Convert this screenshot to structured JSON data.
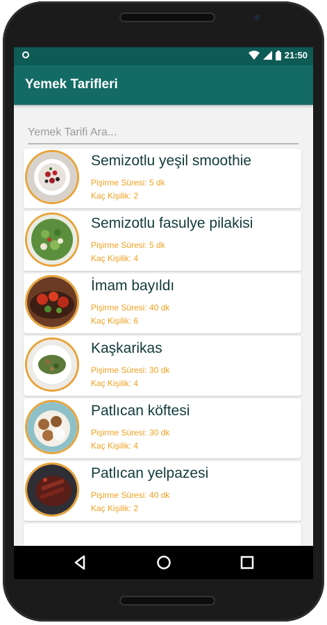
{
  "status": {
    "time": "21:50"
  },
  "appbar": {
    "title": "Yemek Tarifleri"
  },
  "search": {
    "placeholder": "Yemek Tarifi Ara..."
  },
  "recipes": [
    {
      "name": "Semizotlu yeşil smoothie",
      "time": "Pişirme Süresi: 5 dk",
      "servings": "Kaç Kişilik: 2"
    },
    {
      "name": "Semizotlu fasulye pilakisi",
      "time": "Pişirme Süresi: 5 dk",
      "servings": "Kaç Kişilik: 4"
    },
    {
      "name": "İmam bayıldı",
      "time": "Pişirme Süresi: 40 dk",
      "servings": "Kaç Kişilik: 6"
    },
    {
      "name": "Kaşkarikas",
      "time": "Pişirme Süresi: 30 dk",
      "servings": "Kaç Kişilik: 4"
    },
    {
      "name": "Patlıcan köftesi",
      "time": "Pişirme Süresi: 30 dk",
      "servings": "Kaç Kişilik: 4"
    },
    {
      "name": "Patlıcan yelpazesi",
      "time": "Pişirme Süresi: 40 dk",
      "servings": "Kaç Kişilik: 2"
    }
  ],
  "colors": {
    "statusbar": "#0e5b55",
    "appbar": "#146b65",
    "accent": "#f0a020",
    "thumb_border": "#e7a33a"
  },
  "icons": {
    "status_left": "notification-icon",
    "wifi": "wifi-icon",
    "signal": "signal-icon",
    "battery": "battery-icon",
    "back": "back-icon",
    "home": "home-icon",
    "recents": "recents-icon"
  }
}
